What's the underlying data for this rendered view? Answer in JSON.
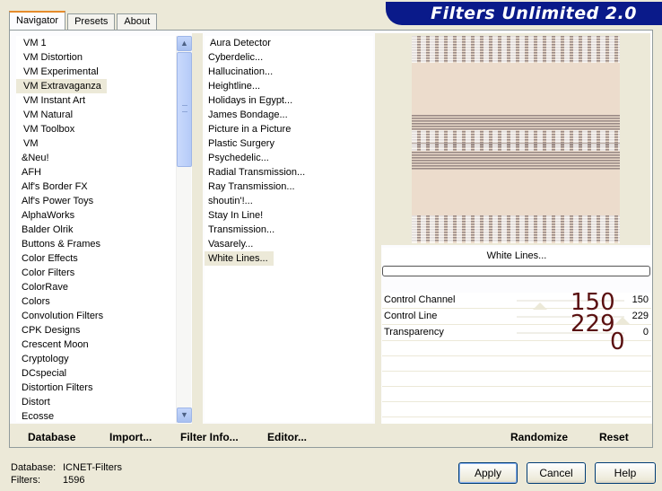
{
  "tabs": [
    "Navigator",
    "Presets",
    "About"
  ],
  "app_title": "Filters Unlimited 2.0",
  "categories": [
    "VM 1",
    "VM Distortion",
    "VM Experimental",
    "VM Extravaganza",
    "VM Instant Art",
    "VM Natural",
    "VM Toolbox",
    "VM",
    "&Neu!",
    "AFH",
    "Alf's Border FX",
    "Alf's Power Toys",
    "AlphaWorks",
    "Balder Olrik",
    "Buttons & Frames",
    "Color Effects",
    "Color Filters",
    "ColorRave",
    "Colors",
    "Convolution Filters",
    "CPK Designs",
    "Crescent Moon",
    "Cryptology",
    "DCspecial",
    "Distortion Filters",
    "Distort",
    "Ecosse"
  ],
  "selected_category": "VM Extravaganza",
  "filters": [
    "Aura Detector",
    "Cyberdelic...",
    "Hallucination...",
    "Heightline...",
    "Holidays in Egypt...",
    "James Bondage...",
    "Picture in a Picture",
    "Plastic Surgery",
    "Psychedelic...",
    "Radial Transmission...",
    "Ray Transmission...",
    "shoutin'!...",
    "Stay In Line!",
    "Transmission...",
    "Vasarely...",
    "White Lines..."
  ],
  "selected_filter": "White Lines...",
  "preview_filter_name": "White Lines...",
  "progress": 0,
  "controls": [
    {
      "label": "Control Channel",
      "value": "150",
      "overlay": "150"
    },
    {
      "label": "Control Line",
      "value": "229",
      "overlay": "229"
    },
    {
      "label": "Transparency",
      "value": "0",
      "overlay": "0"
    }
  ],
  "panel_buttons": {
    "database": "Database",
    "import": "Import...",
    "filter_info": "Filter Info...",
    "editor": "Editor...",
    "randomize": "Randomize",
    "reset": "Reset"
  },
  "footer": {
    "database_label": "Database:",
    "database_value": "ICNET-Filters",
    "filters_label": "Filters:",
    "filters_value": "1596"
  },
  "dialog_buttons": {
    "apply": "Apply",
    "cancel": "Cancel",
    "help": "Help"
  },
  "colors": {
    "banner": "#0a1a8a",
    "preview_bg": "#ecdccc",
    "stripe_dark": "#9a8a86",
    "overlay_text": "#5a1010"
  }
}
